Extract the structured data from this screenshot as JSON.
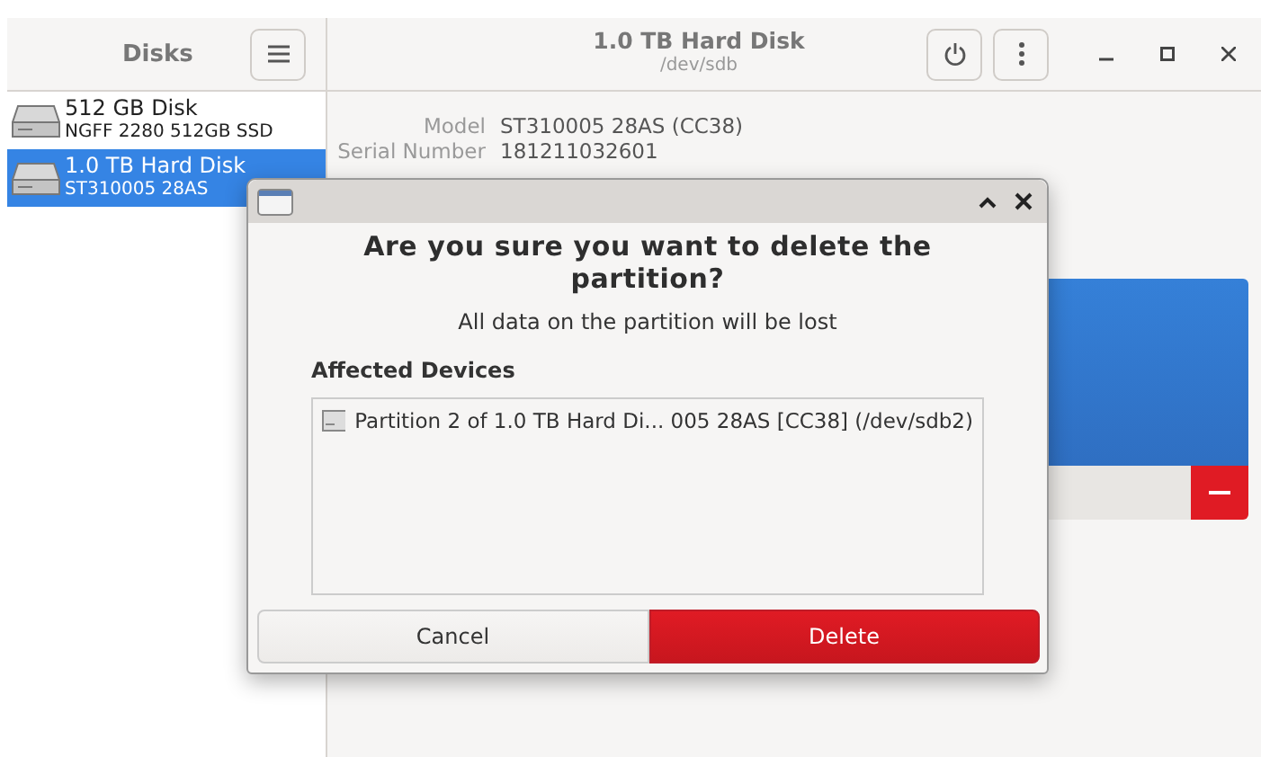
{
  "sidebar": {
    "title": "Disks",
    "disks": [
      {
        "name": "512 GB Disk",
        "detail": "NGFF 2280 512GB SSD",
        "selected": false
      },
      {
        "name": "1.0 TB Hard Disk",
        "detail": "ST310005 28AS",
        "selected": true
      }
    ]
  },
  "header": {
    "title": "1.0 TB Hard Disk",
    "subtitle": "/dev/sdb"
  },
  "details": [
    {
      "label": "Model",
      "value": "ST310005 28AS (CC38)"
    },
    {
      "label": "Serial Number",
      "value": "181211032601"
    }
  ],
  "dialog": {
    "heading": "Are you sure you want to delete the partition?",
    "message": "All data on the partition will be lost",
    "section": "Affected Devices",
    "devices": [
      "Partition 2 of 1.0 TB Hard Di... 005 28AS [CC38] (/dev/sdb2)"
    ],
    "buttons": [
      {
        "label": "Cancel",
        "kind": "normal"
      },
      {
        "label": "Delete",
        "kind": "destructive"
      }
    ]
  }
}
